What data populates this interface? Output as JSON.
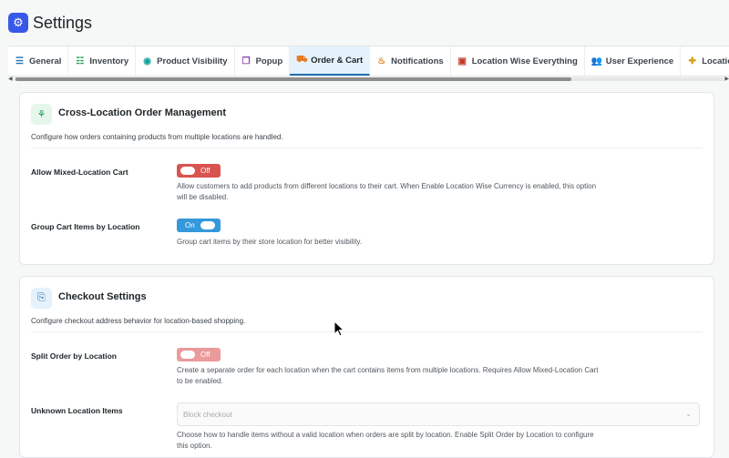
{
  "header": {
    "title": "Settings",
    "logo_icon": "gear-icon"
  },
  "tabs": [
    {
      "label": "General",
      "icon": "sliders-icon",
      "color": "#2271b1"
    },
    {
      "label": "Inventory",
      "icon": "list-icon",
      "color": "#1e9e57"
    },
    {
      "label": "Product Visibility",
      "icon": "eye-icon",
      "color": "#14a098"
    },
    {
      "label": "Popup",
      "icon": "window-icon",
      "color": "#8e44ad"
    },
    {
      "label": "Order & Cart",
      "icon": "truck-icon",
      "color": "#e8791f",
      "active": true
    },
    {
      "label": "Notifications",
      "icon": "bell-icon",
      "color": "#e0851f"
    },
    {
      "label": "Location Wise Everything",
      "icon": "map-icon",
      "color": "#c0392b"
    },
    {
      "label": "User Experience",
      "icon": "users-icon",
      "color": "#17a2b8"
    },
    {
      "label": "Location Info Management",
      "icon": "puzzle-icon",
      "color": "#d4a017"
    },
    {
      "label": "",
      "icon": "menu-icon",
      "color": "#2271b1"
    }
  ],
  "cards": {
    "cross": {
      "title": "Cross-Location Order Management",
      "description": "Configure how orders containing products from multiple locations are handled.",
      "icon": "handshake-icon",
      "mixed_cart": {
        "label": "Allow Mixed-Location Cart",
        "toggle": "Off",
        "help": "Allow customers to add products from different locations to their cart. When Enable Location Wise Currency is enabled, this option will be disabled."
      },
      "group_items": {
        "label": "Group Cart Items by Location",
        "toggle": "On",
        "help": "Group cart items by their store location for better visibility."
      }
    },
    "checkout": {
      "title": "Checkout Settings",
      "description": "Configure checkout address behavior for location-based shopping.",
      "icon": "clipboard-icon",
      "split_order": {
        "label": "Split Order by Location",
        "toggle": "Off",
        "help": "Create a separate order for each location when the cart contains items from multiple locations. Requires Allow Mixed-Location Cart to be enabled."
      },
      "unknown_items": {
        "label": "Unknown Location Items",
        "select_value": "Block checkout",
        "help": "Choose how to handle items without a valid location when orders are split by location. Enable Split Order by Location to configure this option."
      }
    }
  }
}
